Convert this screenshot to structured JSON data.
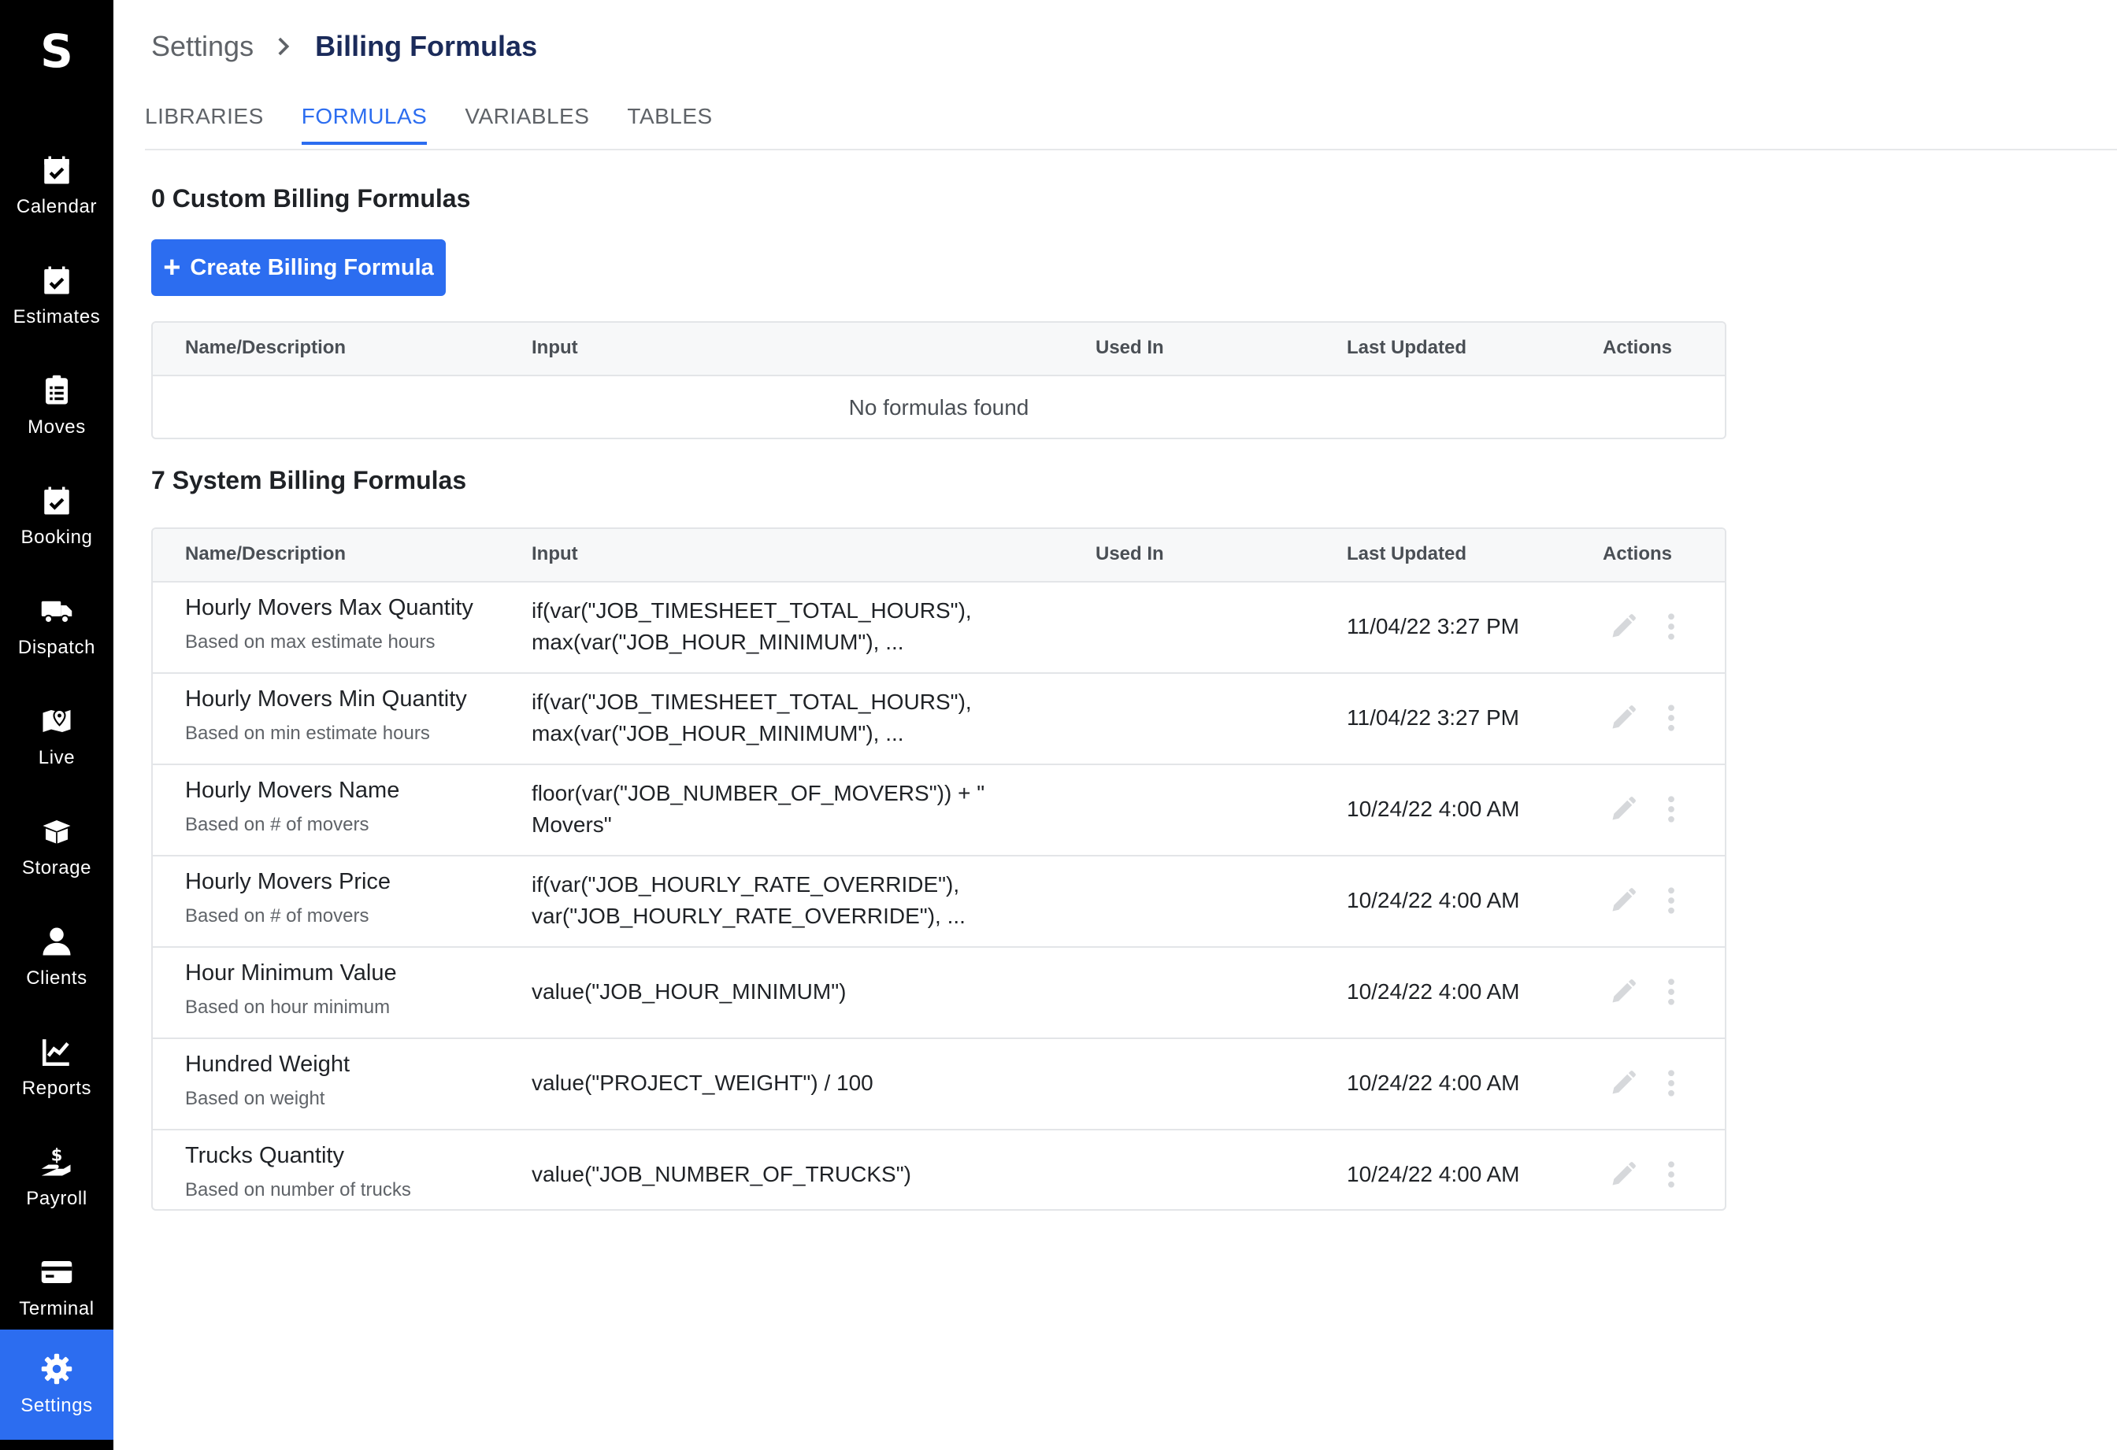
{
  "app": {
    "logo": "S"
  },
  "sidebar": {
    "items": [
      {
        "label": "Calendar",
        "icon": "calendar-check-icon"
      },
      {
        "label": "Estimates",
        "icon": "calendar-check-icon"
      },
      {
        "label": "Moves",
        "icon": "clipboard-list-icon"
      },
      {
        "label": "Booking",
        "icon": "calendar-check-icon"
      },
      {
        "label": "Dispatch",
        "icon": "truck-icon"
      },
      {
        "label": "Live",
        "icon": "map-pin-icon"
      },
      {
        "label": "Storage",
        "icon": "box-open-icon"
      },
      {
        "label": "Clients",
        "icon": "user-icon"
      },
      {
        "label": "Reports",
        "icon": "chart-line-icon"
      },
      {
        "label": "Payroll",
        "icon": "hand-dollar-icon"
      },
      {
        "label": "Terminal",
        "icon": "credit-card-icon"
      },
      {
        "label": "Settings",
        "icon": "gear-icon",
        "active": true
      }
    ]
  },
  "header": {
    "breadcrumb_parent": "Settings",
    "breadcrumb_current": "Billing Formulas"
  },
  "tabs": [
    {
      "label": "LIBRARIES"
    },
    {
      "label": "FORMULAS",
      "active": true
    },
    {
      "label": "VARIABLES"
    },
    {
      "label": "TABLES"
    }
  ],
  "custom": {
    "title": "0 Custom Billing Formulas",
    "create_label": "Create Billing Formula",
    "empty_text": "No formulas found"
  },
  "system": {
    "title": "7 System Billing Formulas",
    "rows": [
      {
        "name": "Hourly Movers Max Quantity",
        "desc": "Based on max estimate hours",
        "input": "if(var(\"JOB_TIMESHEET_TOTAL_HOURS\"),\nmax(var(\"JOB_HOUR_MINIMUM\"), ...",
        "used_in": "",
        "updated": "11/04/22 3:27 PM"
      },
      {
        "name": "Hourly Movers Min Quantity",
        "desc": "Based on min estimate hours",
        "input": "if(var(\"JOB_TIMESHEET_TOTAL_HOURS\"),\nmax(var(\"JOB_HOUR_MINIMUM\"), ...",
        "used_in": "",
        "updated": "11/04/22 3:27 PM"
      },
      {
        "name": "Hourly Movers Name",
        "desc": "Based on # of movers",
        "input": "floor(var(\"JOB_NUMBER_OF_MOVERS\")) + \"\nMovers\"",
        "used_in": "",
        "updated": "10/24/22 4:00 AM"
      },
      {
        "name": "Hourly Movers Price",
        "desc": "Based on # of movers",
        "input": "if(var(\"JOB_HOURLY_RATE_OVERRIDE\"),\nvar(\"JOB_HOURLY_RATE_OVERRIDE\"), ...",
        "used_in": "",
        "updated": "10/24/22 4:00 AM"
      },
      {
        "name": "Hour Minimum Value",
        "desc": "Based on hour minimum",
        "input": "value(\"JOB_HOUR_MINIMUM\")",
        "used_in": "",
        "updated": "10/24/22 4:00 AM"
      },
      {
        "name": "Hundred Weight",
        "desc": "Based on weight",
        "input": "value(\"PROJECT_WEIGHT\") / 100",
        "used_in": "",
        "updated": "10/24/22 4:00 AM"
      },
      {
        "name": "Trucks Quantity",
        "desc": "Based on number of trucks",
        "input": "value(\"JOB_NUMBER_OF_TRUCKS\")",
        "used_in": "",
        "updated": "10/24/22 4:00 AM"
      }
    ]
  },
  "table_headers": {
    "name": "Name/Description",
    "input": "Input",
    "used_in": "Used In",
    "updated": "Last Updated",
    "actions": "Actions"
  },
  "colors": {
    "sidebar_bg": "#000000",
    "accent": "#2c6df0",
    "breadcrumb_current": "#1b2b5a",
    "border": "#e3e5e8",
    "muted_icon": "#d6d8db"
  }
}
